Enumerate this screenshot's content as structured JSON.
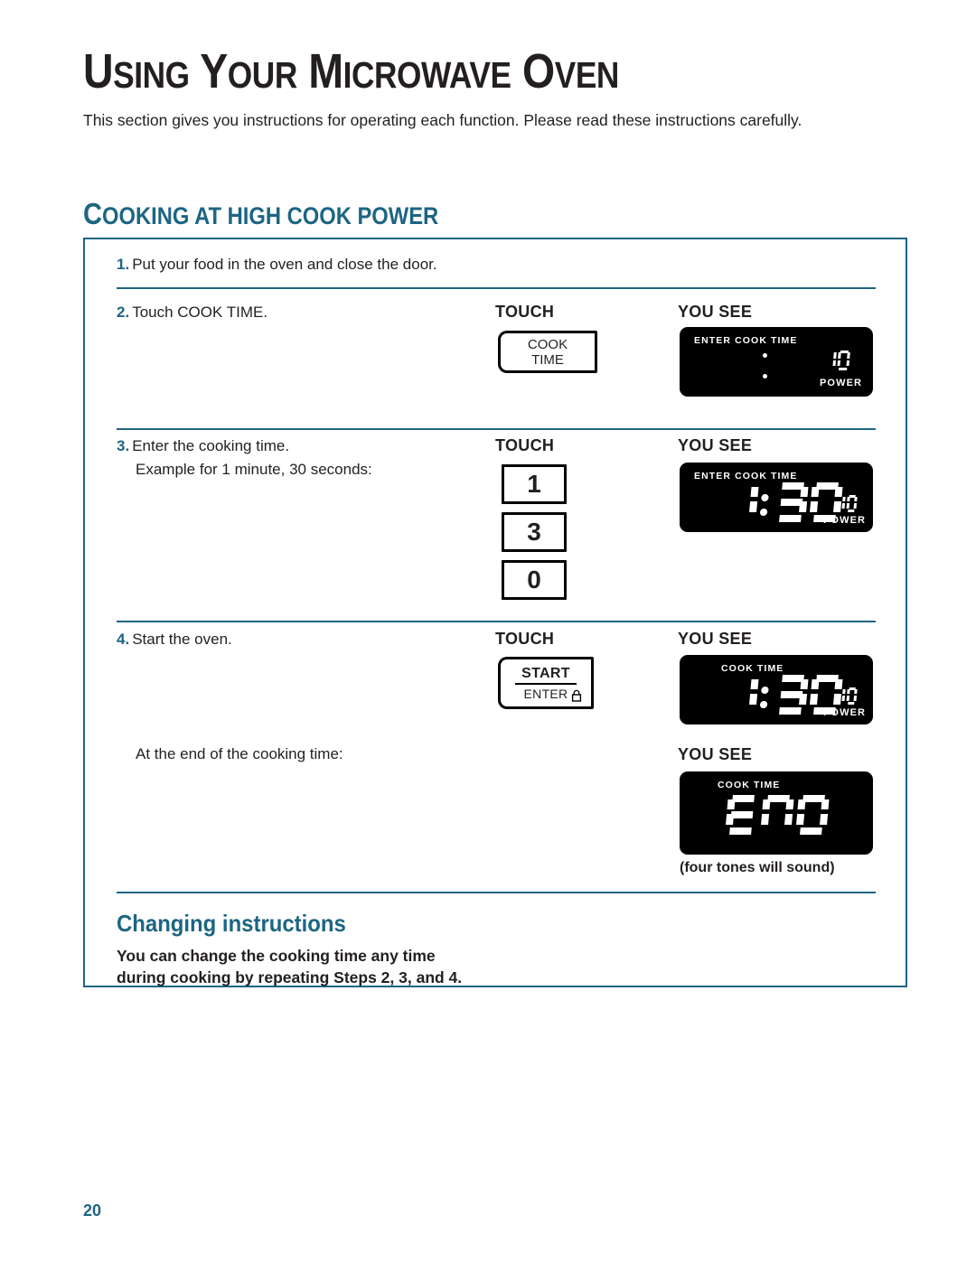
{
  "page": {
    "title_words": [
      "Using",
      "Your",
      "Microwave",
      "Oven"
    ],
    "intro": "This section gives you instructions for operating each function. Please read these instructions carefully.",
    "section_heading": "Cooking at high cook power",
    "page_number": "20",
    "accent_color": "#1d6583",
    "text_color": "#231f20"
  },
  "columns": {
    "touch": "TOUCH",
    "you_see": "YOU SEE"
  },
  "steps": [
    {
      "num": "1.",
      "text": "Put your food in the oven and close the door."
    },
    {
      "num": "2.",
      "text": "Touch COOK TIME."
    },
    {
      "num": "3.",
      "text": "Enter the cooking time.",
      "sub": "Example for 1 minute, 30 seconds:"
    },
    {
      "num": "4.",
      "text": "Start the oven."
    }
  ],
  "end_note": "At the end of the cooking time:",
  "buttons": {
    "cook_time": {
      "line1": "COOK",
      "line2": "TIME"
    },
    "digits": [
      "1",
      "3",
      "0"
    ],
    "start": {
      "primary": "START",
      "secondary": "ENTER",
      "icon": "lock-icon"
    }
  },
  "displays": [
    {
      "id": "display-enter-cook-time",
      "labels": "ENTER  COOK  TIME",
      "time": "",
      "power_value": "10",
      "power_word": "POWER",
      "colon_visible": true
    },
    {
      "id": "display-1-30-enter",
      "labels": "ENTER  COOK  TIME",
      "time": "1:30",
      "power_value": "10",
      "power_word": "POWER",
      "colon_visible": true
    },
    {
      "id": "display-1-30-cooking",
      "labels": "COOK  TIME",
      "time": "1:30",
      "power_value": "10",
      "power_word": "POWER",
      "colon_visible": true
    },
    {
      "id": "display-end",
      "labels": "COOK  TIME",
      "time": "END",
      "power_value": "",
      "power_word": "",
      "colon_visible": false
    }
  ],
  "four_tones": "(four tones will sound)",
  "changing": {
    "heading": "Changing instructions",
    "body_line1": "You can change the cooking time any time",
    "body_line2": "during cooking by repeating Steps 2, 3, and 4."
  }
}
